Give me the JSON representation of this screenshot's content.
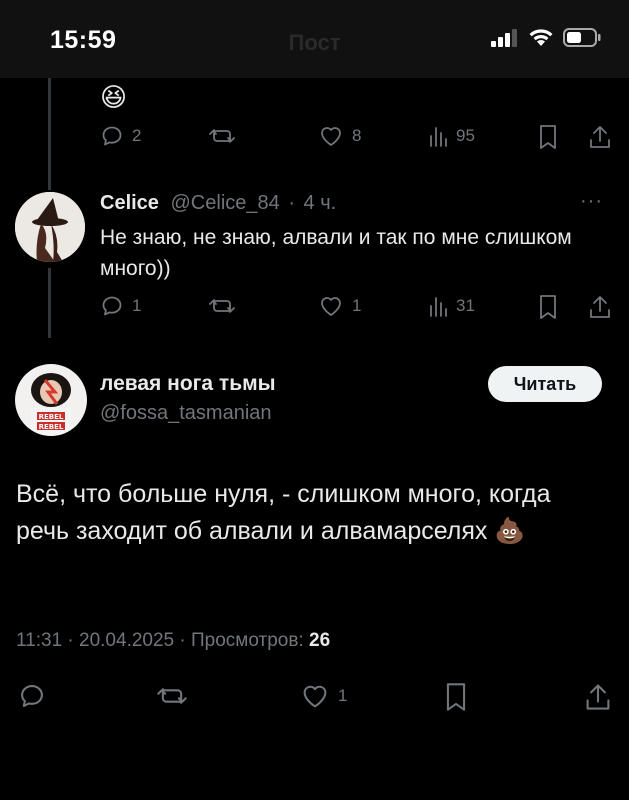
{
  "status_bar": {
    "time": "15:59",
    "title": "Пост"
  },
  "prev_tweet": {
    "emoji": "😆",
    "actions": {
      "replies": "2",
      "likes": "8",
      "views": "95"
    }
  },
  "reply": {
    "name": "Celice",
    "handle": "@Celice_84",
    "time": "4 ч.",
    "separator": "·",
    "more": "···",
    "text": "Не знаю, не знаю, алвали и так по мне слишком много))",
    "actions": {
      "replies": "1",
      "likes": "1",
      "views": "31"
    }
  },
  "main_tweet": {
    "name": "левая нога тьмы",
    "handle": "@fossa_tasmanian",
    "follow_label": "Читать",
    "text": "Всё, что больше нуля, - слишком много, когда речь заходит об алвали и алвамарселях 💩",
    "meta_prefix": "11:31 · 20.04.2025 · Просмотров: ",
    "views": "26",
    "actions": {
      "likes": "1"
    }
  },
  "icons": [
    "signal-icon",
    "wifi-icon",
    "battery-icon",
    "reply-icon",
    "retweet-icon",
    "like-icon",
    "views-icon",
    "bookmark-icon",
    "share-icon"
  ],
  "colors": {
    "background": "#000000",
    "text": "#e7e9ea",
    "muted": "#71767b",
    "thread_line": "#333639",
    "button_bg": "#eff3f4"
  }
}
